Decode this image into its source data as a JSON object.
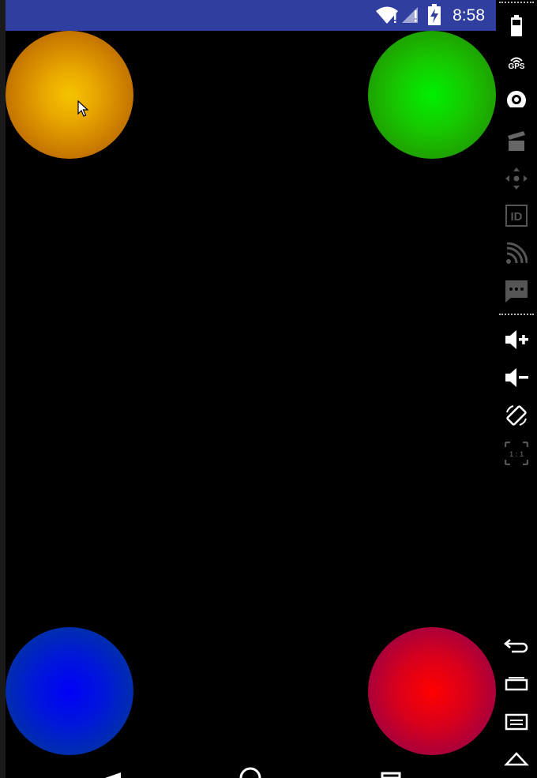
{
  "status_bar": {
    "time": "8:58",
    "color": "#303f9f",
    "icons": [
      "wifi-icon",
      "signal-icon",
      "battery-charging-icon"
    ]
  },
  "balls": [
    {
      "name": "orange-ball",
      "color": "#e8a600"
    },
    {
      "name": "green-ball",
      "color": "#00f000"
    },
    {
      "name": "blue-ball",
      "color": "#0000f8"
    },
    {
      "name": "red-ball",
      "color": "#ff0000"
    }
  ],
  "side_toolbar": {
    "gps_label": "GPS",
    "id_label": "ID",
    "scale_label": "1 : 1",
    "tools": [
      "battery-icon",
      "gps-icon",
      "camera-icon",
      "screen-record-icon",
      "dpad-icon",
      "id-icon",
      "cast-icon",
      "sms-icon",
      "volume-up-icon",
      "volume-down-icon",
      "rotate-icon",
      "scale-icon",
      "back-icon",
      "overview-icon",
      "menu-icon",
      "home-icon"
    ]
  }
}
